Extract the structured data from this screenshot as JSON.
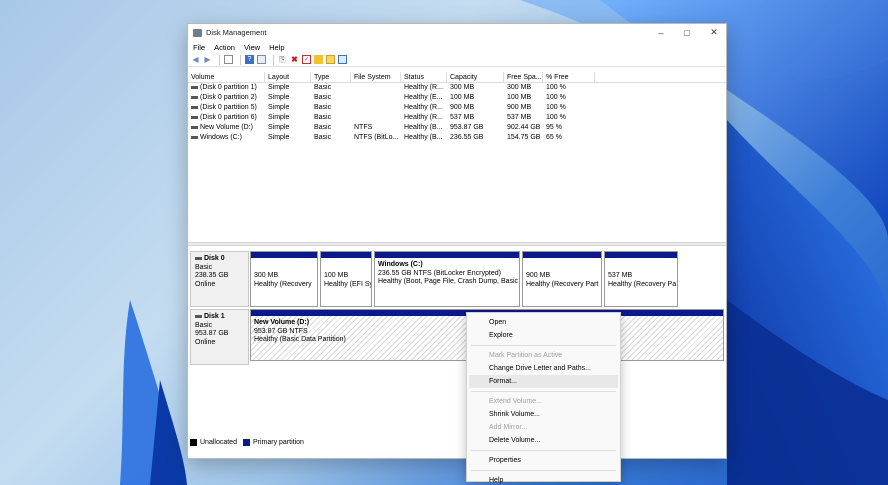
{
  "window": {
    "title": "Disk Management"
  },
  "menu": [
    "File",
    "Action",
    "View",
    "Help"
  ],
  "toolbar_icons": [
    "back-icon",
    "forward-icon",
    "show-hide-icon",
    "help-icon",
    "properties-icon",
    "connect-icon",
    "delete-icon",
    "check-icon",
    "folder-icon",
    "new-icon",
    "list-icon"
  ],
  "volume_table": {
    "columns": [
      "Volume",
      "Layout",
      "Type",
      "File System",
      "Status",
      "Capacity",
      "Free Spa...",
      "% Free"
    ],
    "rows": [
      [
        "(Disk 0 partition 1)",
        "Simple",
        "Basic",
        "",
        "Healthy (R...",
        "300 MB",
        "300 MB",
        "100 %"
      ],
      [
        "(Disk 0 partition 2)",
        "Simple",
        "Basic",
        "",
        "Healthy (E...",
        "100 MB",
        "100 MB",
        "100 %"
      ],
      [
        "(Disk 0 partition 5)",
        "Simple",
        "Basic",
        "",
        "Healthy (R...",
        "900 MB",
        "900 MB",
        "100 %"
      ],
      [
        "(Disk 0 partition 6)",
        "Simple",
        "Basic",
        "",
        "Healthy (R...",
        "537 MB",
        "537 MB",
        "100 %"
      ],
      [
        "New Volume (D:)",
        "Simple",
        "Basic",
        "NTFS",
        "Healthy (B...",
        "953.87 GB",
        "902.44 GB",
        "95 %"
      ],
      [
        "Windows (C:)",
        "Simple",
        "Basic",
        "NTFS (BitLo...",
        "Healthy (B...",
        "236.55 GB",
        "154.75 GB",
        "65 %"
      ]
    ]
  },
  "disks": [
    {
      "name": "Disk 0",
      "type": "Basic",
      "size": "238.35 GB",
      "state": "Online",
      "partitions": [
        {
          "title": "",
          "line1": "300 MB",
          "line2": "Healthy (Recovery"
        },
        {
          "title": "",
          "line1": "100 MB",
          "line2": "Healthy (EFI Sy"
        },
        {
          "title": "Windows  (C:)",
          "line1": "236.55 GB NTFS (BitLocker Encrypted)",
          "line2": "Healthy (Boot, Page File, Crash Dump, Basic"
        },
        {
          "title": "",
          "line1": "900 MB",
          "line2": "Healthy (Recovery Part"
        },
        {
          "title": "",
          "line1": "537 MB",
          "line2": "Healthy (Recovery Pa"
        }
      ]
    },
    {
      "name": "Disk 1",
      "type": "Basic",
      "size": "953.87 GB",
      "state": "Online",
      "partitions": [
        {
          "title": "New Volume  (D:)",
          "line1": "953.87 GB NTFS",
          "line2": "Healthy (Basic Data Partition)"
        }
      ]
    }
  ],
  "legend": [
    {
      "label": "Unallocated",
      "color": "#000000"
    },
    {
      "label": "Primary partition",
      "color": "#0b1a8a"
    }
  ],
  "context_menu": [
    {
      "label": "Open",
      "enabled": true
    },
    {
      "label": "Explore",
      "enabled": true
    },
    {
      "sep": true
    },
    {
      "label": "Mark Partition as Active",
      "enabled": false
    },
    {
      "label": "Change Drive Letter and Paths...",
      "enabled": true
    },
    {
      "label": "Format...",
      "enabled": true,
      "hover": true
    },
    {
      "sep": true
    },
    {
      "label": "Extend Volume...",
      "enabled": false
    },
    {
      "label": "Shrink Volume...",
      "enabled": true
    },
    {
      "label": "Add Mirror...",
      "enabled": false
    },
    {
      "label": "Delete Volume...",
      "enabled": true
    },
    {
      "sep": true
    },
    {
      "label": "Properties",
      "enabled": true
    },
    {
      "sep": true
    },
    {
      "label": "Help",
      "enabled": true
    }
  ]
}
